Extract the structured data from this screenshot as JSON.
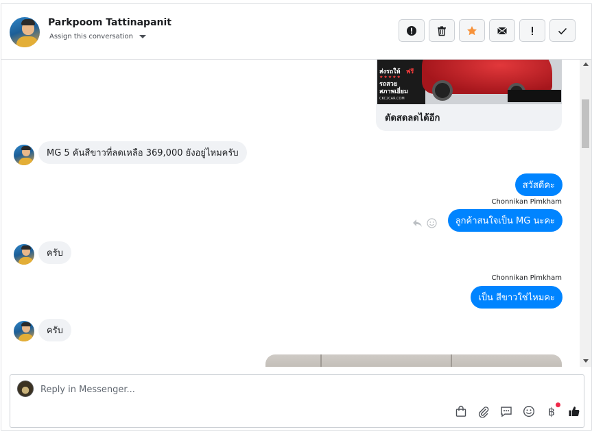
{
  "header": {
    "contact_name": "Parkpoom Tattinapanit",
    "assign_label": "Assign this conversation",
    "actions": [
      {
        "name": "mark-spam-button",
        "icon": "alert-circle-icon",
        "title": "Mark as spam"
      },
      {
        "name": "delete-button",
        "icon": "trash-icon",
        "title": "Delete"
      },
      {
        "name": "star-button",
        "icon": "star-icon",
        "title": "Star"
      },
      {
        "name": "mark-unread-button",
        "icon": "envelope-icon",
        "title": "Mark as unread"
      },
      {
        "name": "follow-up-button",
        "icon": "exclamation-icon",
        "title": "Follow up"
      },
      {
        "name": "mark-done-button",
        "icon": "check-icon",
        "title": "Mark as done"
      }
    ]
  },
  "card": {
    "image_text_1": "ส่งรถให้",
    "image_text_1b": "ฟรี",
    "image_stars": "★★★★★",
    "image_text_2": "รถสวย\nสภาพเยี่ยม",
    "image_text_3": "CKC2CAR.COM",
    "caption": "ตัดสดลดได้อีก"
  },
  "messages": [
    {
      "direction": "in",
      "text": "MG 5 คันสีขาวที่ลดเหลือ 369,000 ยังอยู่ไหมครับ"
    },
    {
      "direction": "out",
      "text": "สวัสดีคะ"
    },
    {
      "direction": "out",
      "sender": "Chonnikan Pimkham",
      "text": "ลูกค้าสนใจเป็น MG นะคะ"
    },
    {
      "direction": "in",
      "text": "ครับ"
    },
    {
      "direction": "out",
      "sender": "Chonnikan Pimkham",
      "text": "เป็น สีขาวใช่ไหมคะ"
    },
    {
      "direction": "in",
      "text": "ครับ"
    }
  ],
  "composer": {
    "placeholder": "Reply in Messenger...",
    "tools": [
      "shopping-bag-icon",
      "paperclip-icon",
      "saved-reply-icon",
      "emoji-icon",
      "baht-icon",
      "thumbs-up-icon"
    ]
  },
  "colors": {
    "outgoing_bubble": "#0084ff",
    "incoming_bubble": "#f0f2f5",
    "star": "#f7923a",
    "notification_dot": "#f02849"
  }
}
